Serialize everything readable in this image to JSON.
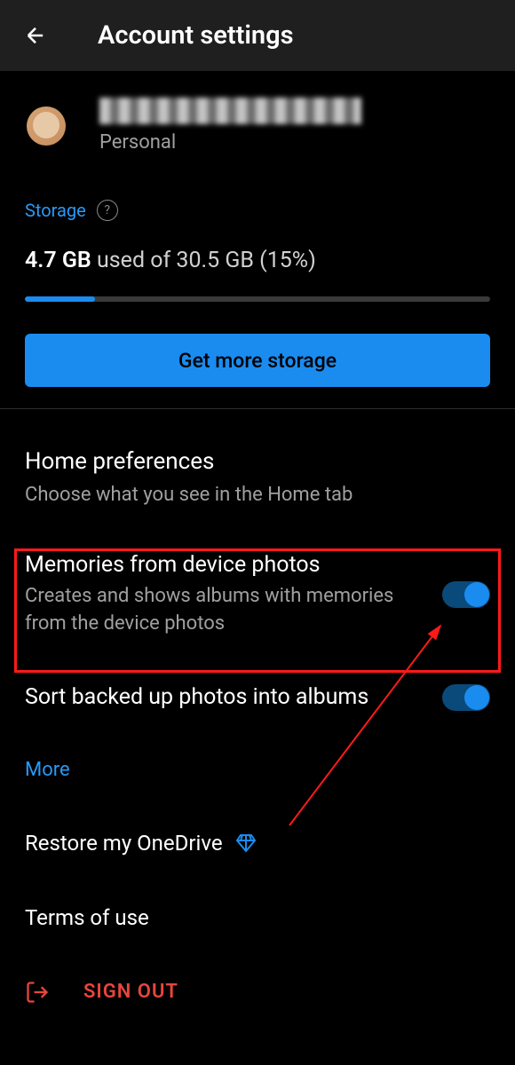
{
  "header": {
    "title": "Account settings"
  },
  "profile": {
    "type": "Personal"
  },
  "storage": {
    "label": "Storage",
    "used": "4.7 GB",
    "of_text": "used of 30.5 GB (15%)",
    "percent": 15,
    "button_label": "Get more storage"
  },
  "preferences": {
    "title": "Home preferences",
    "subtitle": "Choose what you see in the Home tab"
  },
  "settings": {
    "memories": {
      "title": "Memories from device photos",
      "desc": "Creates and shows albums with memories from the device photos",
      "enabled": true
    },
    "sort": {
      "title": "Sort backed up photos into albums",
      "enabled": true
    }
  },
  "more": "More",
  "restore": "Restore my OneDrive",
  "terms": "Terms of use",
  "signout": "SIGN OUT"
}
